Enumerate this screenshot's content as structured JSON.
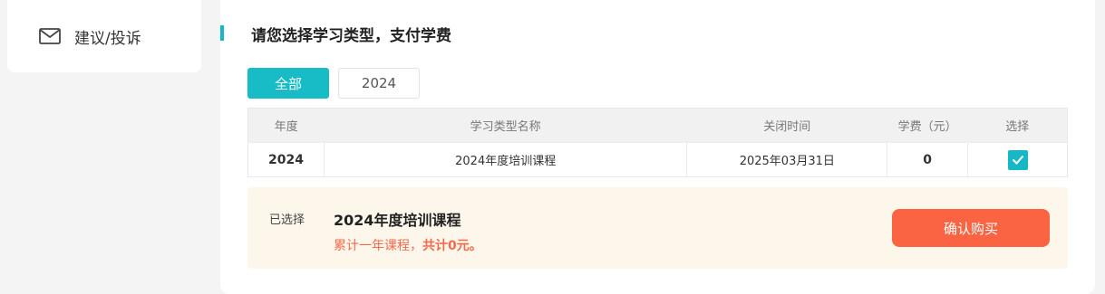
{
  "sidebar": {
    "items": [
      {
        "label": "建议/投诉",
        "icon": "mail-icon"
      }
    ]
  },
  "main": {
    "title": "请您选择学习类型，支付学费",
    "tabs": [
      {
        "label": "全部",
        "active": true
      },
      {
        "label": "2024",
        "active": false
      }
    ],
    "table": {
      "headers": [
        "年度",
        "学习类型名称",
        "关闭时间",
        "学费（元）",
        "选择"
      ],
      "rows": [
        {
          "year": "2024",
          "name": "2024年度培训课程",
          "close_time": "2025年03月31日",
          "fee": "0",
          "selected": true
        }
      ]
    },
    "summary": {
      "label": "已选择",
      "course": "2024年度培训课程",
      "total_prefix": "累计一年课程，",
      "total_strong": "共计0元。",
      "confirm_label": "确认购买"
    }
  },
  "colors": {
    "accent": "#18b7c6",
    "price": "#f26a4b",
    "confirm": "#fb6443",
    "summary_bg": "#fdf7eb"
  }
}
